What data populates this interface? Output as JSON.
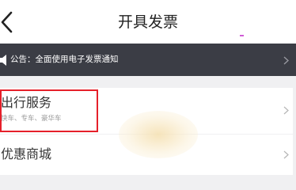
{
  "header": {
    "title": "开具发票",
    "back_icon": "chevron-left-icon"
  },
  "notice": {
    "text": "公告：全面使用电子发票通知",
    "icon": "speaker-icon",
    "arrow_icon": "chevron-right-icon"
  },
  "items": [
    {
      "label": "出行服务",
      "sub": "快车、专车、豪华车",
      "arrow_icon": "chevron-right-icon",
      "highlighted": true
    },
    {
      "label": "优惠商城",
      "arrow_icon": "chevron-right-icon"
    }
  ],
  "colors": {
    "notice_bg": "#3b3d45",
    "highlight_border": "#e5202a",
    "page_bg": "#f0f0f2"
  }
}
